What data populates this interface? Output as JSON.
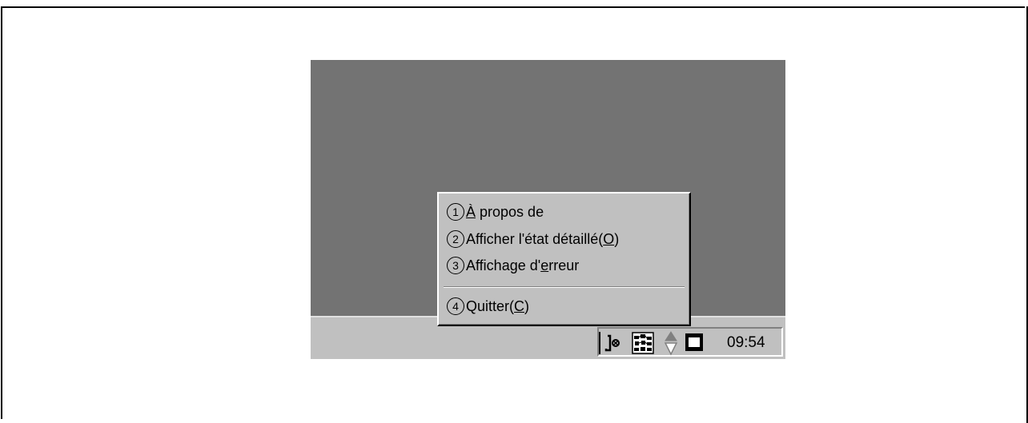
{
  "menu": {
    "items": [
      {
        "num": "1",
        "pre": "",
        "acc": "À",
        "post": " propos de"
      },
      {
        "num": "2",
        "pre": "Afficher l'état détaillé(",
        "acc": "O",
        "post": ")"
      },
      {
        "num": "3",
        "pre": "Affichage d'",
        "acc": "e",
        "post": "rreur"
      },
      {
        "num": "4",
        "pre": "Quitter(",
        "acc": "C",
        "post": ")"
      }
    ]
  },
  "tray": {
    "clock": "09:54",
    "icons": [
      "printer-status-icon",
      "network-icon",
      "speaker-icon",
      "window-icon"
    ]
  },
  "colors": {
    "desktop": "#737373",
    "taskbar": "#c0c0c0",
    "menu": "#c0c0c0"
  }
}
